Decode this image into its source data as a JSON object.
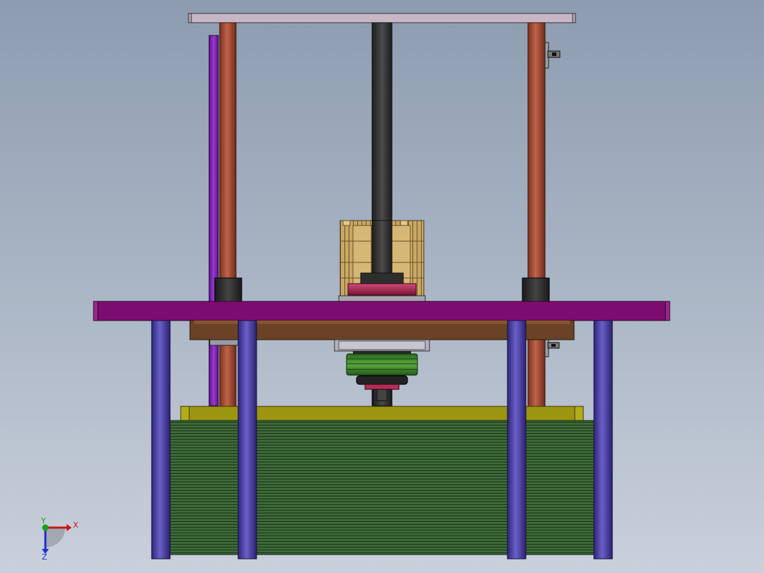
{
  "view": {
    "kind": "3D CAD assembly, front orthographic view",
    "background_top": "#8d9cb0",
    "background_bottom": "#c9d0db"
  },
  "triad": {
    "x_label": "X",
    "y_label": "Y",
    "z_label": "Z",
    "x_color": "#d01515",
    "y_color": "#19a019",
    "z_color": "#1b2fd6"
  },
  "part_colors": {
    "top_plate": "#c7b7c4",
    "guide_column": "#b0543e",
    "lead_screw": "#3a3a3a",
    "purple_rod": "#7a1fb0",
    "column_bushing": "#2c2c2c",
    "gear_block": "#c9a865",
    "mid_table": "#7c0d70",
    "brown_plate": "#6a4225",
    "legs": "#4a3fa0",
    "yellow_base": "#9c9510",
    "coil_stack": "#3f6b3b",
    "green_disc": "#3f8a2e",
    "red_ring": "#b42c5a"
  }
}
